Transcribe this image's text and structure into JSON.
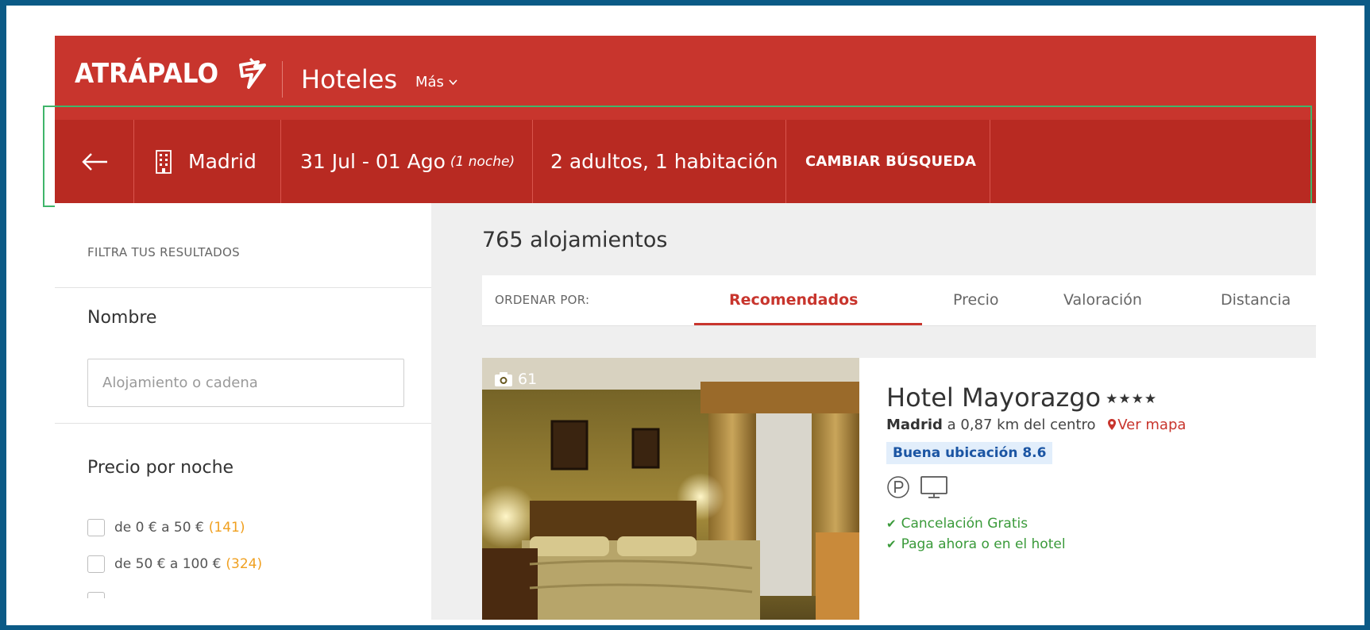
{
  "header": {
    "logo_text": "ATRÁPALO",
    "nav_title": "Hoteles",
    "more_label": "Más"
  },
  "search": {
    "city": "Madrid",
    "dates": "31 Jul - 01 Ago",
    "nights": "(1 noche)",
    "guests": "2 adultos, 1 habitación",
    "change_label": "CAMBIAR BÚSQUEDA"
  },
  "sidebar": {
    "filter_title": "FILTRA TUS RESULTADOS",
    "name_label": "Nombre",
    "name_placeholder": "Alojamiento o cadena",
    "price_label": "Precio por noche",
    "price_ranges": [
      {
        "label": "de 0 € a 50 €",
        "count": "(141)"
      },
      {
        "label": "de 50 € a 100 €",
        "count": "(324)"
      }
    ]
  },
  "results": {
    "count_label": "765 alojamientos",
    "sort_label": "ORDENAR POR:",
    "sort_tabs": [
      "Recomendados",
      "Precio",
      "Valoración",
      "Distancia"
    ],
    "active_tab": "Recomendados"
  },
  "hotel": {
    "photo_count": "61",
    "name": "Hotel Mayorazgo",
    "stars": "★★★★",
    "city": "Madrid",
    "distance": "a 0,87 km del centro",
    "map_link": "Ver mapa",
    "rating": "Buena ubicación 8.6",
    "amenities": [
      "parking-icon",
      "tv-icon"
    ],
    "features": [
      "Cancelación Gratis",
      "Paga ahora o en el hotel"
    ]
  },
  "colors": {
    "brand_red": "#c8352d",
    "search_bar_red": "#b82a22",
    "highlight_green": "#3fb56a",
    "feature_green": "#3a9a3a",
    "rating_blue": "#1b55a3",
    "count_orange": "#f0a020"
  }
}
